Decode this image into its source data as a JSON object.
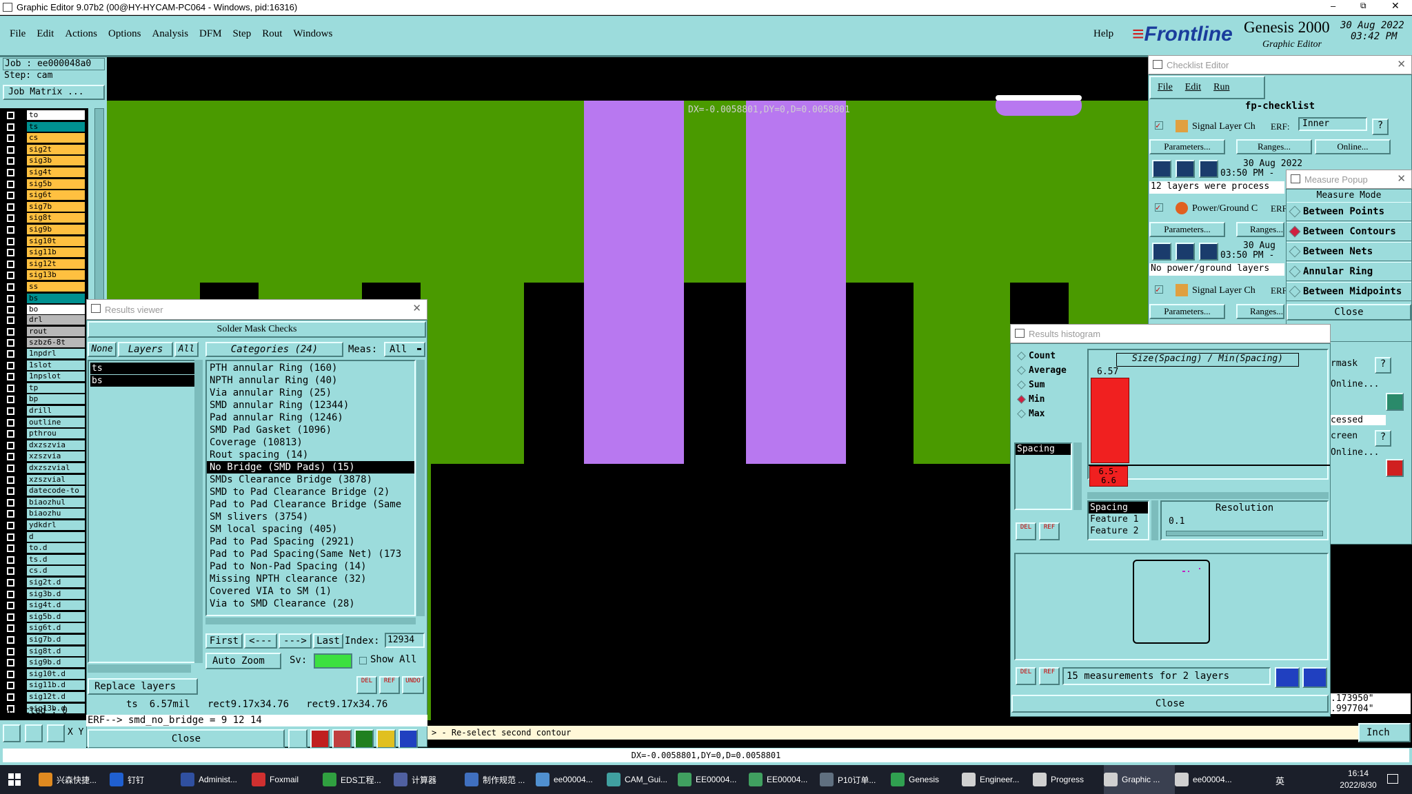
{
  "window": {
    "title": "Graphic Editor 9.07b2 (00@HY-HYCAM-PC064 - Windows, pid:16316)"
  },
  "menubar": {
    "items": [
      "File",
      "Edit",
      "Actions",
      "Options",
      "Analysis",
      "DFM",
      "Step",
      "Rout",
      "Windows"
    ],
    "help": "Help"
  },
  "brand": {
    "logo": "Frontline",
    "product": "Genesis 2000",
    "subtitle": "Graphic Editor",
    "date": "30 Aug 2022",
    "time": "03:42 PM"
  },
  "job": {
    "job_label": "Job : ee000048a0",
    "step_label": "Step: cam",
    "matrix_button": "Job Matrix ..."
  },
  "layers": {
    "group1": [
      {
        "name": "to",
        "color": "#ffffff"
      },
      {
        "name": "ts",
        "color": "#009090"
      },
      {
        "name": "cs",
        "color": "#ffc040"
      },
      {
        "name": "sig2t",
        "color": "#ffc040"
      },
      {
        "name": "sig3b",
        "color": "#ffc040"
      },
      {
        "name": "sig4t",
        "color": "#ffc040"
      },
      {
        "name": "sig5b",
        "color": "#ffc040"
      },
      {
        "name": "sig6t",
        "color": "#ffc040"
      },
      {
        "name": "sig7b",
        "color": "#ffc040"
      },
      {
        "name": "sig8t",
        "color": "#ffc040"
      },
      {
        "name": "sig9b",
        "color": "#ffc040"
      },
      {
        "name": "sig10t",
        "color": "#ffc040"
      },
      {
        "name": "sig11b",
        "color": "#ffc040"
      },
      {
        "name": "sig12t",
        "color": "#ffc040"
      },
      {
        "name": "sig13b",
        "color": "#ffc040"
      },
      {
        "name": "ss",
        "color": "#ffc040"
      },
      {
        "name": "bs",
        "color": "#009090"
      },
      {
        "name": "bo",
        "color": "#ffffff"
      }
    ],
    "group2": [
      {
        "name": "drl",
        "color": "#b8b8b8"
      },
      {
        "name": "rout",
        "color": "#b8b8b8"
      },
      {
        "name": "szbz6-8t",
        "color": "#b8b8b8"
      }
    ],
    "group3": [
      "1npdrl",
      "1slot",
      "1npslot",
      "tp",
      "bp",
      "drill",
      "outline",
      "pthrou",
      "dxzszvia",
      "xzszvia",
      "dxzszvial",
      "xzszvial",
      "datecode-to",
      "biaozhul",
      "biaozhu",
      "ydkdrl",
      "d",
      "to.d",
      "ts.d",
      "cs.d",
      "sig2t.d",
      "sig3b.d",
      "sig4t.d",
      "sig5b.d",
      "sig6t.d",
      "sig7b.d",
      "sig8t.d",
      "sig9b.d",
      "sig10t.d",
      "sig11b.d",
      "sig12t.d",
      "sig13b.d"
    ],
    "selected_label": "Selected : 0"
  },
  "canvas": {
    "measure_text": "DX=-0.0058801,DY=0,D=0.0058801"
  },
  "results_viewer": {
    "title": "Results viewer",
    "header": "Solder Mask Checks",
    "none_btn": "None",
    "layers_btn": "Layers",
    "all_btn": "All",
    "categories_label": "Categories (24)",
    "meas_label": "Meas:",
    "meas_value": "All",
    "layers": [
      "ts",
      "bs"
    ],
    "categories": [
      "PTH annular Ring (160)",
      "NPTH annular Ring (40)",
      "Via annular Ring (25)",
      "SMD annular Ring (12344)",
      "Pad annular Ring (1246)",
      "SMD Pad Gasket (1096)",
      "Coverage (10813)",
      "Rout spacing (14)",
      "No Bridge (SMD Pads) (15)",
      "SMDs Clearance Bridge (3878)",
      "SMD to Pad Clearance Bridge (2)",
      "Pad to Pad Clearance Bridge (Same",
      "SM slivers (3754)",
      "SM local spacing (405)",
      "Pad to Pad Spacing (2921)",
      "Pad to Pad Spacing(Same Net) (173",
      "Pad to Non-Pad Spacing (14)",
      "Missing NPTH clearance (32)",
      "Covered VIA to SM (1)",
      "Via to SMD Clearance (28)"
    ],
    "selected_category_index": 8,
    "nav": {
      "first": "First",
      "prev": "<---",
      "next": "--->",
      "last": "Last",
      "index_label": "Index:",
      "index_value": "12934"
    },
    "replace_layers": "Replace layers",
    "auto_zoom": "Auto Zoom",
    "sv_label": "Sv:",
    "show_all": "Show All",
    "status": "ts  6.57mil   rect9.17x34.76   rect9.17x34.76",
    "icons": {
      "del": "DEL",
      "ref": "REF",
      "undo": "UNDO"
    }
  },
  "erf_line": "ERF--> smd_no_bridge = 9 12 14",
  "close_label": "Close",
  "prompt_line": "> - Re-select second contour",
  "status_bar": "DX=-0.0058801,DY=0,D=0.0058801",
  "xy_label": "X Y",
  "units": "Inch",
  "coord_readout": [
    ".173950\"",
    ".997704\""
  ],
  "checklist": {
    "title": "Checklist Editor",
    "menu": [
      "File",
      "Edit",
      "Run"
    ],
    "name": "fp-checklist",
    "items": [
      {
        "label": "Signal Layer Ch",
        "erf": "ERF:",
        "erf_value": "Inner",
        "date": "30 Aug 2022",
        "time": "03:50 PM -",
        "summary": "12 layers were process"
      },
      {
        "label": "Power/Ground C",
        "erf": "ERF",
        "date": "30 Aug",
        "time": "03:50 PM -",
        "summary": "No power/ground layers"
      },
      {
        "label": "Signal Layer Ch",
        "erf": "ERF"
      }
    ],
    "params": "Parameters...",
    "ranges": "Ranges...",
    "online": "Online...",
    "right_partial": [
      "rmask",
      "Online...",
      "cessed",
      "creen",
      "Online..."
    ]
  },
  "measure_popup": {
    "title": "Measure Popup",
    "header": "Measure Mode",
    "modes": [
      "Between Points",
      "Between Contours",
      "Between Nets",
      "Annular Ring",
      "Between Midpoints"
    ],
    "selected": "Between Contours",
    "close": "Close"
  },
  "histogram": {
    "title": "Results histogram",
    "stats": [
      "Count",
      "Average",
      "Sum",
      "Min",
      "Max"
    ],
    "selected_stat": "Min",
    "measure_list": [
      "Spacing"
    ],
    "chart_title": "Size(Spacing) / Min(Spacing)",
    "bar_top": "6.57",
    "bar_range": "6.5-",
    "bar_range2": "6.6",
    "fields": [
      "Spacing",
      "Feature 1",
      "Feature 2"
    ],
    "resolution_label": "Resolution",
    "resolution_value": "0.1",
    "summary": "15 measurements for 2 layers",
    "close": "Close"
  },
  "taskbar": {
    "apps": [
      "兴森快捷...",
      "钉钉",
      "Administ...",
      "Foxmail",
      "EDS工程...",
      "计算器",
      "制作规范 ...",
      "ee00004...",
      "CAM_Gui...",
      "EE00004...",
      "EE00004...",
      "P10订单...",
      "Genesis",
      "Engineer...",
      "Progress",
      "Graphic ...",
      "ee00004..."
    ],
    "tray_lang": "英",
    "time": "16:14",
    "date": "2022/8/30"
  }
}
